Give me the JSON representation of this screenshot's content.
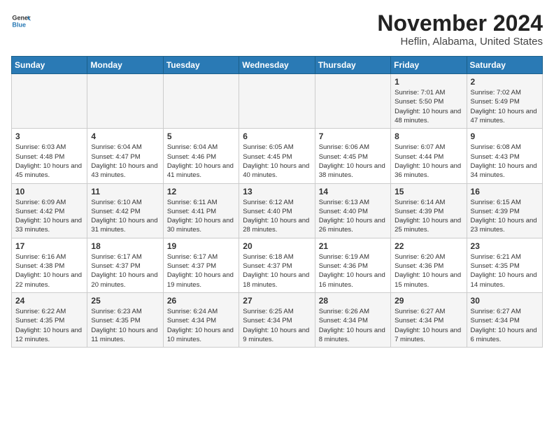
{
  "logo": {
    "line1": "General",
    "line2": "Blue"
  },
  "title": "November 2024",
  "location": "Heflin, Alabama, United States",
  "days_of_week": [
    "Sunday",
    "Monday",
    "Tuesday",
    "Wednesday",
    "Thursday",
    "Friday",
    "Saturday"
  ],
  "weeks": [
    [
      {
        "day": "",
        "info": ""
      },
      {
        "day": "",
        "info": ""
      },
      {
        "day": "",
        "info": ""
      },
      {
        "day": "",
        "info": ""
      },
      {
        "day": "",
        "info": ""
      },
      {
        "day": "1",
        "info": "Sunrise: 7:01 AM\nSunset: 5:50 PM\nDaylight: 10 hours and 48 minutes."
      },
      {
        "day": "2",
        "info": "Sunrise: 7:02 AM\nSunset: 5:49 PM\nDaylight: 10 hours and 47 minutes."
      }
    ],
    [
      {
        "day": "3",
        "info": "Sunrise: 6:03 AM\nSunset: 4:48 PM\nDaylight: 10 hours and 45 minutes."
      },
      {
        "day": "4",
        "info": "Sunrise: 6:04 AM\nSunset: 4:47 PM\nDaylight: 10 hours and 43 minutes."
      },
      {
        "day": "5",
        "info": "Sunrise: 6:04 AM\nSunset: 4:46 PM\nDaylight: 10 hours and 41 minutes."
      },
      {
        "day": "6",
        "info": "Sunrise: 6:05 AM\nSunset: 4:45 PM\nDaylight: 10 hours and 40 minutes."
      },
      {
        "day": "7",
        "info": "Sunrise: 6:06 AM\nSunset: 4:45 PM\nDaylight: 10 hours and 38 minutes."
      },
      {
        "day": "8",
        "info": "Sunrise: 6:07 AM\nSunset: 4:44 PM\nDaylight: 10 hours and 36 minutes."
      },
      {
        "day": "9",
        "info": "Sunrise: 6:08 AM\nSunset: 4:43 PM\nDaylight: 10 hours and 34 minutes."
      }
    ],
    [
      {
        "day": "10",
        "info": "Sunrise: 6:09 AM\nSunset: 4:42 PM\nDaylight: 10 hours and 33 minutes."
      },
      {
        "day": "11",
        "info": "Sunrise: 6:10 AM\nSunset: 4:42 PM\nDaylight: 10 hours and 31 minutes."
      },
      {
        "day": "12",
        "info": "Sunrise: 6:11 AM\nSunset: 4:41 PM\nDaylight: 10 hours and 30 minutes."
      },
      {
        "day": "13",
        "info": "Sunrise: 6:12 AM\nSunset: 4:40 PM\nDaylight: 10 hours and 28 minutes."
      },
      {
        "day": "14",
        "info": "Sunrise: 6:13 AM\nSunset: 4:40 PM\nDaylight: 10 hours and 26 minutes."
      },
      {
        "day": "15",
        "info": "Sunrise: 6:14 AM\nSunset: 4:39 PM\nDaylight: 10 hours and 25 minutes."
      },
      {
        "day": "16",
        "info": "Sunrise: 6:15 AM\nSunset: 4:39 PM\nDaylight: 10 hours and 23 minutes."
      }
    ],
    [
      {
        "day": "17",
        "info": "Sunrise: 6:16 AM\nSunset: 4:38 PM\nDaylight: 10 hours and 22 minutes."
      },
      {
        "day": "18",
        "info": "Sunrise: 6:17 AM\nSunset: 4:37 PM\nDaylight: 10 hours and 20 minutes."
      },
      {
        "day": "19",
        "info": "Sunrise: 6:17 AM\nSunset: 4:37 PM\nDaylight: 10 hours and 19 minutes."
      },
      {
        "day": "20",
        "info": "Sunrise: 6:18 AM\nSunset: 4:37 PM\nDaylight: 10 hours and 18 minutes."
      },
      {
        "day": "21",
        "info": "Sunrise: 6:19 AM\nSunset: 4:36 PM\nDaylight: 10 hours and 16 minutes."
      },
      {
        "day": "22",
        "info": "Sunrise: 6:20 AM\nSunset: 4:36 PM\nDaylight: 10 hours and 15 minutes."
      },
      {
        "day": "23",
        "info": "Sunrise: 6:21 AM\nSunset: 4:35 PM\nDaylight: 10 hours and 14 minutes."
      }
    ],
    [
      {
        "day": "24",
        "info": "Sunrise: 6:22 AM\nSunset: 4:35 PM\nDaylight: 10 hours and 12 minutes."
      },
      {
        "day": "25",
        "info": "Sunrise: 6:23 AM\nSunset: 4:35 PM\nDaylight: 10 hours and 11 minutes."
      },
      {
        "day": "26",
        "info": "Sunrise: 6:24 AM\nSunset: 4:34 PM\nDaylight: 10 hours and 10 minutes."
      },
      {
        "day": "27",
        "info": "Sunrise: 6:25 AM\nSunset: 4:34 PM\nDaylight: 10 hours and 9 minutes."
      },
      {
        "day": "28",
        "info": "Sunrise: 6:26 AM\nSunset: 4:34 PM\nDaylight: 10 hours and 8 minutes."
      },
      {
        "day": "29",
        "info": "Sunrise: 6:27 AM\nSunset: 4:34 PM\nDaylight: 10 hours and 7 minutes."
      },
      {
        "day": "30",
        "info": "Sunrise: 6:27 AM\nSunset: 4:34 PM\nDaylight: 10 hours and 6 minutes."
      }
    ]
  ]
}
